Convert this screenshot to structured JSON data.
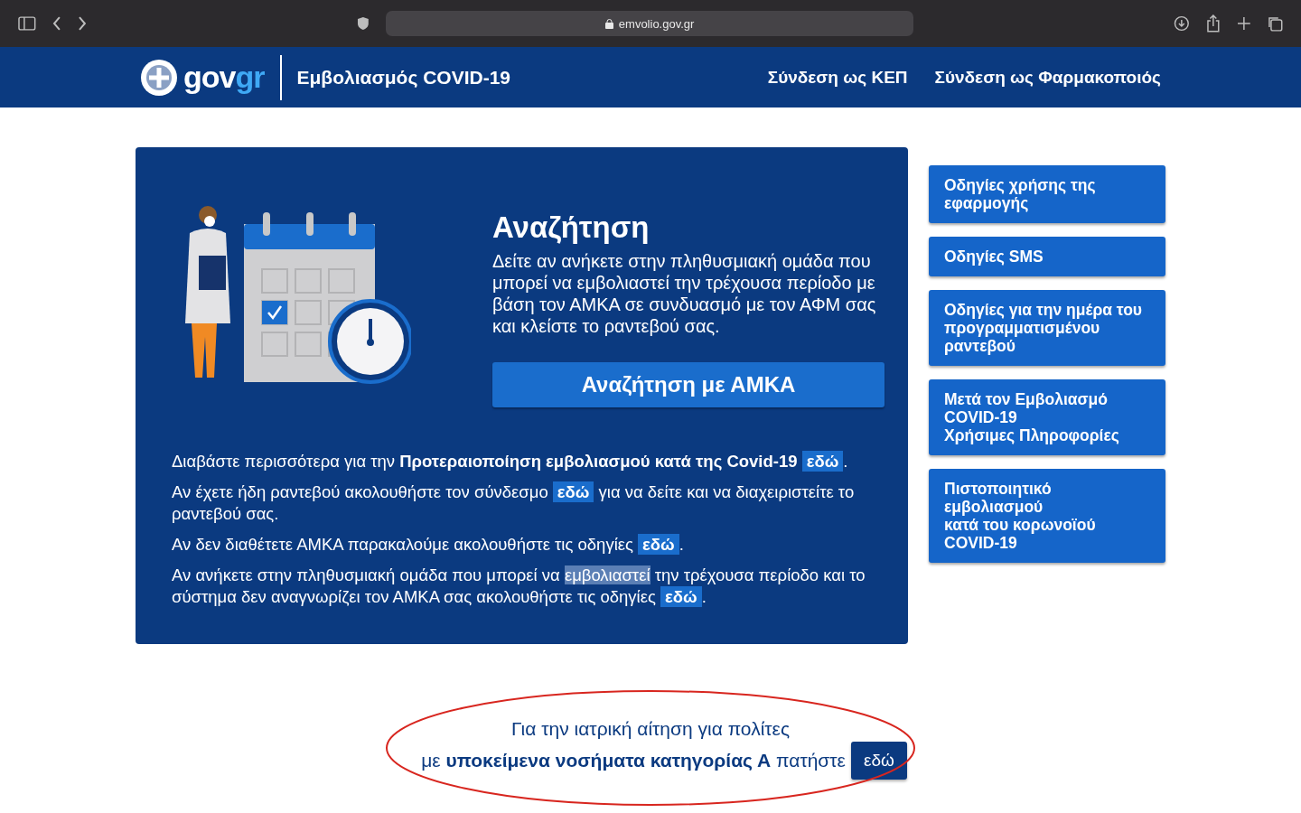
{
  "browser": {
    "url": "emvolio.gov.gr"
  },
  "header": {
    "logo": {
      "part_1": "gov",
      "part_2": "gr"
    },
    "title": "Εμβολιασμός COVID-19",
    "links": [
      "Σύνδεση ως ΚΕΠ",
      "Σύνδεση ως Φαρμακοποιός"
    ]
  },
  "search_card": {
    "title": "Αναζήτηση",
    "description": "Δείτε αν ανήκετε στην πληθυσμιακή ομάδα που μπορεί να εμβολιαστεί την τρέχουσα περίοδο με βάση τον ΑΜΚΑ σε συνδυασμό με τον ΑΦΜ σας και κλείστε το ραντεβού σας.",
    "button": "Αναζήτηση με ΑΜΚΑ",
    "paragraphs": [
      [
        {
          "kind": "text",
          "text": "Διαβάστε περισσότερα για την **Προτεραιοποίηση εμβολιασμού κατά της Covid-19** "
        },
        {
          "kind": "link",
          "text": "εδώ"
        },
        {
          "kind": "text",
          "text": "."
        }
      ],
      [
        {
          "kind": "text",
          "text": "Αν έχετε ήδη ραντεβού ακολουθήστε τον σύνδεσμο "
        },
        {
          "kind": "link",
          "text": "εδώ"
        },
        {
          "kind": "text",
          "text": " για να δείτε και να διαχειριστείτε το ραντεβού σας."
        }
      ],
      [
        {
          "kind": "text",
          "text": "Αν δεν διαθέτετε ΑΜΚΑ παρακαλούμε ακολουθήστε τις οδηγίες "
        },
        {
          "kind": "link",
          "text": "εδώ"
        },
        {
          "kind": "text",
          "text": "."
        }
      ],
      [
        {
          "kind": "text",
          "text": "Αν ανήκετε στην πληθυσμιακή ομάδα που μπορεί να "
        },
        {
          "kind": "selected",
          "text": "εμβολιαστεί"
        },
        {
          "kind": "text",
          "text": " την τρέχουσα περίοδο και το σύστημα δεν αναγνωρίζει τον ΑΜΚΑ σας ακολουθήστε τις οδηγίες "
        },
        {
          "kind": "link",
          "text": "εδώ"
        },
        {
          "kind": "text",
          "text": "."
        }
      ]
    ]
  },
  "sidebar": {
    "buttons": [
      [
        "Οδηγίες χρήσης της εφαρμογής"
      ],
      [
        "Οδηγίες SMS"
      ],
      [
        "Οδηγίες για την ημέρα του προγραμματισμένου ραντεβού"
      ],
      [
        "Μετά τον Εμβολιασμό",
        "COVID-19",
        "Χρήσιμες Πληροφορίες"
      ],
      [
        "Πιστοποιητικό",
        "εμβολιασμού",
        "κατά του κορωνοϊού",
        "COVID-19"
      ]
    ]
  },
  "medical_notice": {
    "line_1": "Για την ιατρική αίτηση για πολίτες",
    "line_2": "με **υποκείμενα νοσήματα κατηγορίας Α** πατήστε",
    "button": "εδώ",
    "circled": true
  }
}
